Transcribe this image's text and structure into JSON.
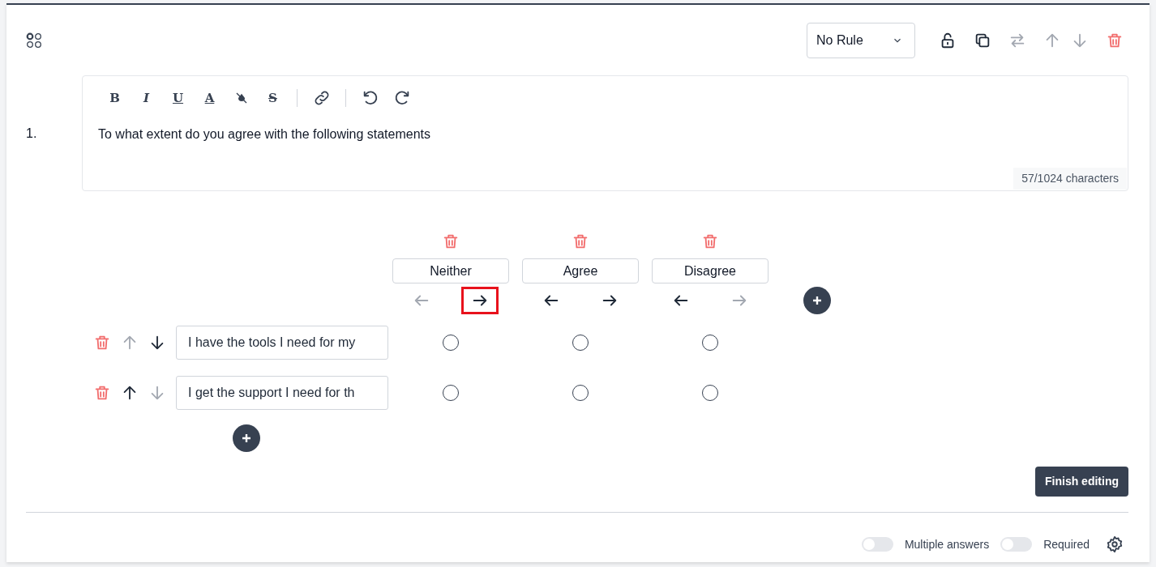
{
  "header": {
    "rule_select": {
      "value": "No Rule"
    },
    "actions": [
      {
        "kind": "lock",
        "disabled": false
      },
      {
        "kind": "copy",
        "disabled": false
      },
      {
        "kind": "swap",
        "disabled": true
      },
      {
        "kind": "up",
        "disabled": true
      },
      {
        "kind": "down",
        "disabled": true
      },
      {
        "kind": "delete",
        "disabled": false
      }
    ]
  },
  "question": {
    "number": "1.",
    "toolbar": [
      {
        "kind": "bold",
        "glyph": "B"
      },
      {
        "kind": "italic",
        "glyph": "I"
      },
      {
        "kind": "underline",
        "glyph": "U"
      },
      {
        "kind": "color",
        "glyph": "A"
      },
      {
        "kind": "highlight"
      },
      {
        "kind": "strike",
        "glyph": "S"
      },
      {
        "kind": "separator"
      },
      {
        "kind": "link"
      },
      {
        "kind": "separator"
      },
      {
        "kind": "undo"
      },
      {
        "kind": "redo"
      }
    ],
    "text": "To what extent do you agree with the following statements",
    "counter": "57/1024 characters"
  },
  "columns": [
    {
      "label": "Neither",
      "left_disabled": true,
      "right_disabled": false,
      "right_focused": true
    },
    {
      "label": "Agree",
      "left_disabled": false,
      "right_disabled": false,
      "right_focused": false
    },
    {
      "label": "Disagree",
      "left_disabled": false,
      "right_disabled": true,
      "right_focused": false
    }
  ],
  "rows": [
    {
      "value": "I have the tools I need for my",
      "up_disabled": true,
      "down_disabled": false,
      "checks": [
        false,
        false,
        false
      ]
    },
    {
      "value": "I get the support I need for th",
      "up_disabled": false,
      "down_disabled": true,
      "checks": [
        false,
        false,
        false
      ]
    }
  ],
  "finish_button": "Finish editing",
  "footer": {
    "toggles": [
      {
        "label": "Multiple answers",
        "on": false
      },
      {
        "label": "Required",
        "on": false
      }
    ]
  }
}
